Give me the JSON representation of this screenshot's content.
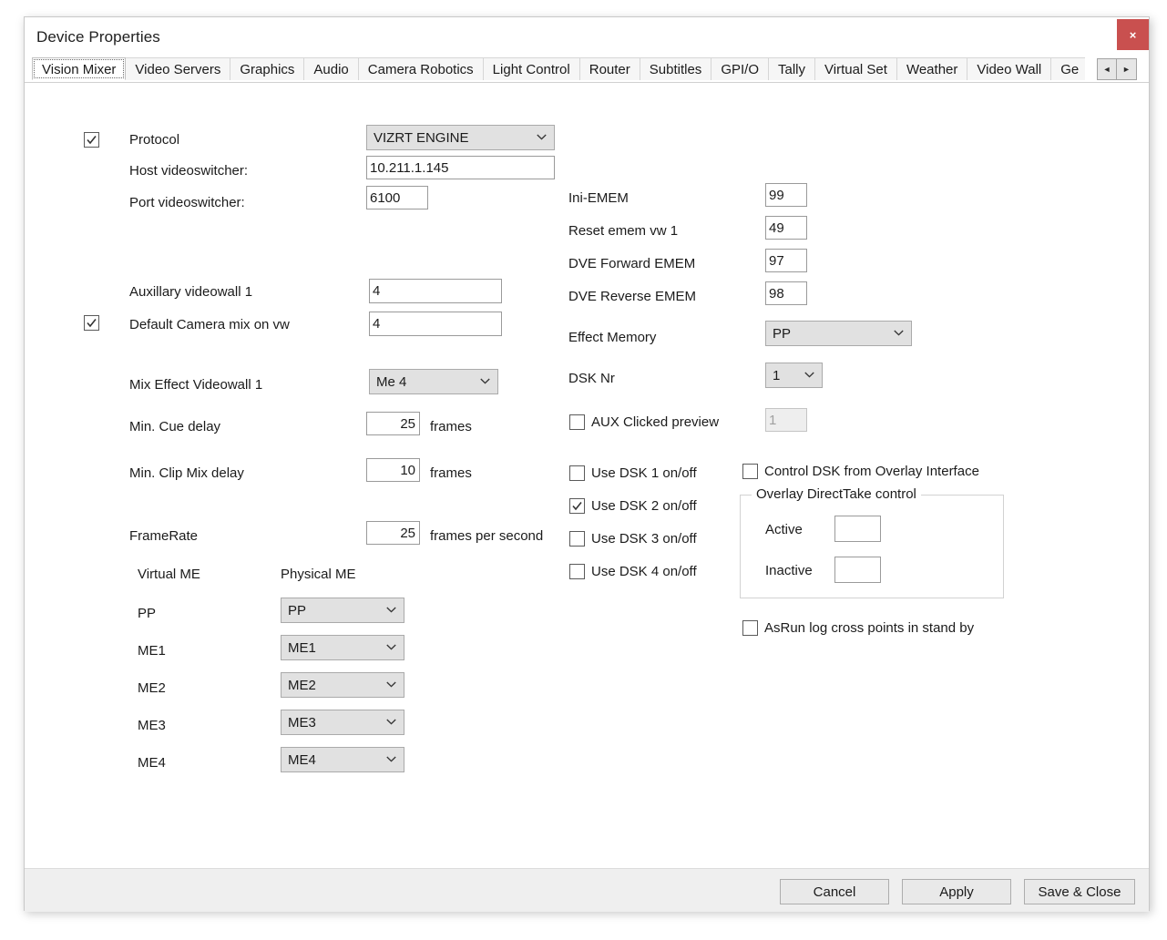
{
  "window": {
    "title": "Device Properties",
    "close_label": "×"
  },
  "tabs": {
    "items": [
      {
        "label": "Vision Mixer",
        "selected": true
      },
      {
        "label": "Video Servers",
        "selected": false
      },
      {
        "label": "Graphics",
        "selected": false
      },
      {
        "label": "Audio",
        "selected": false
      },
      {
        "label": "Camera Robotics",
        "selected": false
      },
      {
        "label": "Light Control",
        "selected": false
      },
      {
        "label": "Router",
        "selected": false
      },
      {
        "label": "Subtitles",
        "selected": false
      },
      {
        "label": "GPI/O",
        "selected": false
      },
      {
        "label": "Tally",
        "selected": false
      },
      {
        "label": "Virtual Set",
        "selected": false
      },
      {
        "label": "Weather",
        "selected": false
      },
      {
        "label": "Video Wall",
        "selected": false
      },
      {
        "label": "Ge",
        "selected": false
      }
    ],
    "scroll_left": "◄",
    "scroll_right": "►"
  },
  "left": {
    "protocol": {
      "checked": true,
      "label": "Protocol",
      "value": "VIZRT ENGINE"
    },
    "host": {
      "label": "Host videoswitcher:",
      "value": "10.211.1.145"
    },
    "port": {
      "label": "Port videoswitcher:",
      "value": "6100"
    },
    "aux_videowall": {
      "label": "Auxillary videowall 1",
      "value": "4"
    },
    "default_camera_mix": {
      "checked": true,
      "label": "Default Camera mix on vw",
      "value": "4"
    },
    "mix_effect_videowall": {
      "label": "Mix Effect Videowall 1",
      "value": "Me 4"
    },
    "cue_delay": {
      "label": "Min. Cue delay",
      "value": "25",
      "unit": "frames"
    },
    "clip_mix_delay": {
      "label": "Min. Clip Mix delay",
      "value": "10",
      "unit": "frames"
    },
    "framerate": {
      "label": "FrameRate",
      "value": "25",
      "unit": "frames per second"
    },
    "me_table": {
      "header_virtual": "Virtual ME",
      "header_physical": "Physical ME",
      "rows": [
        {
          "virtual": "PP",
          "physical": "PP"
        },
        {
          "virtual": "ME1",
          "physical": "ME1"
        },
        {
          "virtual": "ME2",
          "physical": "ME2"
        },
        {
          "virtual": "ME3",
          "physical": "ME3"
        },
        {
          "virtual": "ME4",
          "physical": "ME4"
        }
      ]
    }
  },
  "middle": {
    "ini_emem": {
      "label": "Ini-EMEM",
      "value": "99"
    },
    "reset_emem": {
      "label": "Reset emem vw 1",
      "value": "49"
    },
    "dve_forward": {
      "label": "DVE Forward EMEM",
      "value": "97"
    },
    "dve_reverse": {
      "label": "DVE Reverse EMEM",
      "value": "98"
    },
    "effect_memory": {
      "label": "Effect Memory",
      "value": "PP"
    },
    "dsk_nr": {
      "label": "DSK Nr",
      "value": "1"
    },
    "aux_clicked": {
      "checked": false,
      "label": "AUX Clicked preview",
      "value": "1"
    },
    "dsk_toggles": [
      {
        "checked": false,
        "label": "Use DSK 1 on/off"
      },
      {
        "checked": true,
        "label": "Use DSK 2 on/off"
      },
      {
        "checked": false,
        "label": "Use DSK 3 on/off"
      },
      {
        "checked": false,
        "label": "Use DSK 4 on/off"
      }
    ]
  },
  "right": {
    "control_dsk": {
      "checked": false,
      "label": "Control DSK from Overlay Interface"
    },
    "overlay_group": {
      "title": "Overlay DirectTake control",
      "active_label": "Active",
      "active_value": "",
      "inactive_label": "Inactive",
      "inactive_value": ""
    },
    "asrun": {
      "checked": false,
      "label": "AsRun log cross points in stand by"
    }
  },
  "footer": {
    "cancel": "Cancel",
    "apply": "Apply",
    "save_close": "Save & Close"
  }
}
